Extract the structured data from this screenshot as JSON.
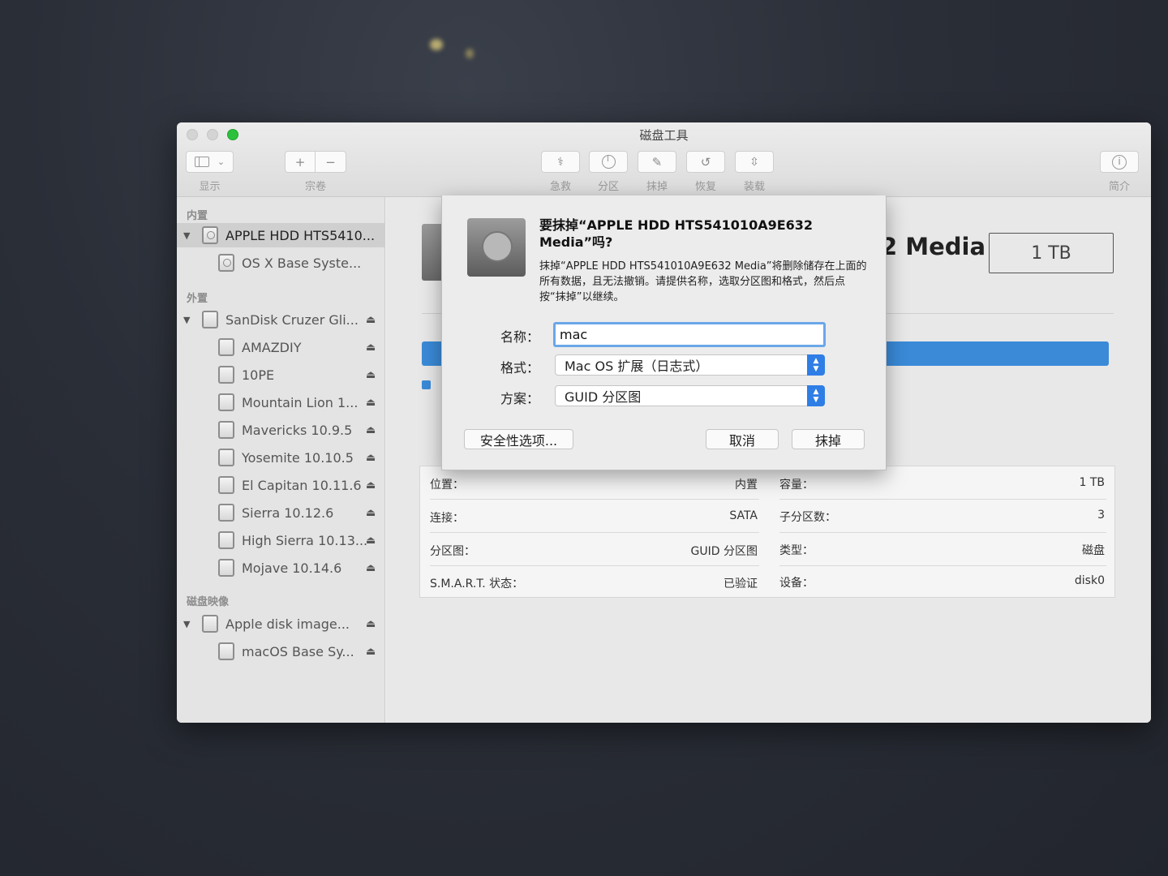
{
  "window": {
    "title": "磁盘工具"
  },
  "toolbar": {
    "view_label": "显示",
    "volume_label": "宗卷",
    "add_symbol": "+",
    "remove_symbol": "−",
    "first_aid_label": "急救",
    "partition_label": "分区",
    "erase_label": "抹掉",
    "restore_label": "恢复",
    "mount_label": "装载",
    "info_label": "简介"
  },
  "sidebar": {
    "internal_header": "内置",
    "external_header": "外置",
    "images_header": "磁盘映像",
    "internal": [
      {
        "label": "APPLE HDD HTS5410...",
        "level": 0,
        "selected": true,
        "eject": false
      },
      {
        "label": "OS X Base Syste...",
        "level": 1,
        "selected": false,
        "eject": false
      }
    ],
    "external": [
      {
        "label": "SanDisk Cruzer Gli...",
        "level": 0,
        "eject": true
      },
      {
        "label": "AMAZDIY",
        "level": 1,
        "eject": true
      },
      {
        "label": "10PE",
        "level": 1,
        "eject": true
      },
      {
        "label": "Mountain Lion 1...",
        "level": 1,
        "eject": true
      },
      {
        "label": "Mavericks 10.9.5",
        "level": 1,
        "eject": true
      },
      {
        "label": "Yosemite 10.10.5",
        "level": 1,
        "eject": true
      },
      {
        "label": "El Capitan 10.11.6",
        "level": 1,
        "eject": true
      },
      {
        "label": "Sierra 10.12.6",
        "level": 1,
        "eject": true
      },
      {
        "label": "High Sierra 10.13...",
        "level": 1,
        "eject": true
      },
      {
        "label": "Mojave 10.14.6",
        "level": 1,
        "eject": true
      }
    ],
    "images": [
      {
        "label": "Apple disk image...",
        "level": 0,
        "eject": true
      },
      {
        "label": "macOS Base Sy...",
        "level": 1,
        "eject": true
      }
    ]
  },
  "main": {
    "title_fragment": "2 Media",
    "capacity_badge": "1 TB",
    "info": {
      "location_label": "位置：",
      "location_value": "内置",
      "capacity_label": "容量：",
      "capacity_value": "1 TB",
      "connection_label": "连接：",
      "connection_value": "SATA",
      "children_label": "子分区数：",
      "children_value": "3",
      "partition_map_label": "分区图：",
      "partition_map_value": "GUID 分区图",
      "type_label": "类型：",
      "type_value": "磁盘",
      "smart_label": "S.M.A.R.T. 状态：",
      "smart_value": "已验证",
      "device_label": "设备：",
      "device_value": "disk0"
    }
  },
  "dialog": {
    "title": "要抹掉“APPLE HDD HTS541010A9E632 Media”吗?",
    "description": "抹掉“APPLE HDD HTS541010A9E632 Media”将删除储存在上面的所有数据，且无法撤销。请提供名称，选取分区图和格式，然后点按“抹掉”以继续。",
    "name_label": "名称：",
    "name_value": "mac",
    "format_label": "格式：",
    "format_value": "Mac OS 扩展（日志式）",
    "scheme_label": "方案：",
    "scheme_value": "GUID 分区图",
    "security_button": "安全性选项...",
    "cancel_button": "取消",
    "erase_button": "抹掉"
  },
  "colors": {
    "accent_blue": "#2f7ee6",
    "usage_bar": "#3a8ad8",
    "maximize_green": "#2bc13d"
  }
}
